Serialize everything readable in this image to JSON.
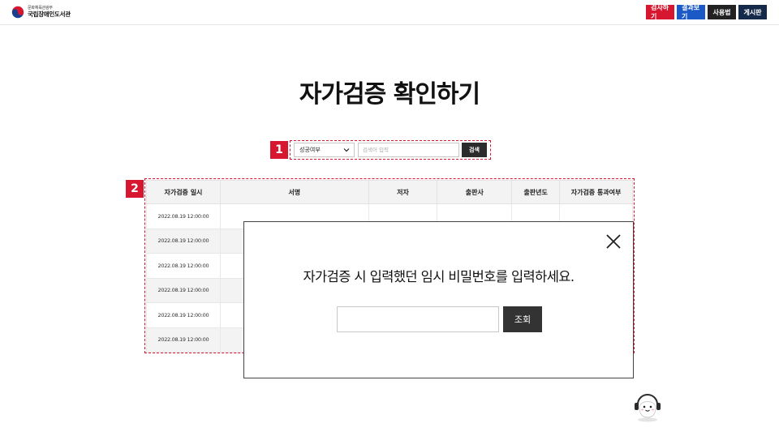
{
  "header": {
    "ministry": "문화체육관광부",
    "library": "국립장애인도서관",
    "nav": [
      {
        "label": "검사하기",
        "color": "#d7172f"
      },
      {
        "label": "결과보기",
        "color": "#1b59c6"
      },
      {
        "label": "사용법",
        "color": "#222222"
      },
      {
        "label": "게시판",
        "color": "#152a4a"
      }
    ]
  },
  "page": {
    "title": "자가검증 확인하기"
  },
  "markers": [
    "1",
    "2"
  ],
  "search": {
    "select_value": "성공여부",
    "input_placeholder": "검색어 입력",
    "button_label": "검색"
  },
  "table": {
    "columns": [
      "자가검증 일시",
      "서명",
      "저자",
      "출판사",
      "출판년도",
      "자가검증 통과여부"
    ],
    "rows": [
      [
        "2022.08.19 12:00:00",
        "",
        "",
        "",
        "",
        ""
      ],
      [
        "2022.08.19 12:00:00",
        "",
        "",
        "",
        "",
        ""
      ],
      [
        "2022.08.19 12:00:00",
        "",
        "",
        "",
        "",
        ""
      ],
      [
        "2022.08.19 12:00:00",
        "",
        "",
        "",
        "",
        ""
      ],
      [
        "2022.08.19 12:00:00",
        "",
        "",
        "",
        "",
        ""
      ],
      [
        "2022.08.19 12:00:00",
        "",
        "",
        "",
        "",
        ""
      ]
    ]
  },
  "modal": {
    "message": "자가검증 시 입력했던 임시 비밀번호를 입력하세요.",
    "button_label": "조회"
  },
  "colors": {
    "accent_red": "#d7172f",
    "dark_button": "#333333"
  }
}
